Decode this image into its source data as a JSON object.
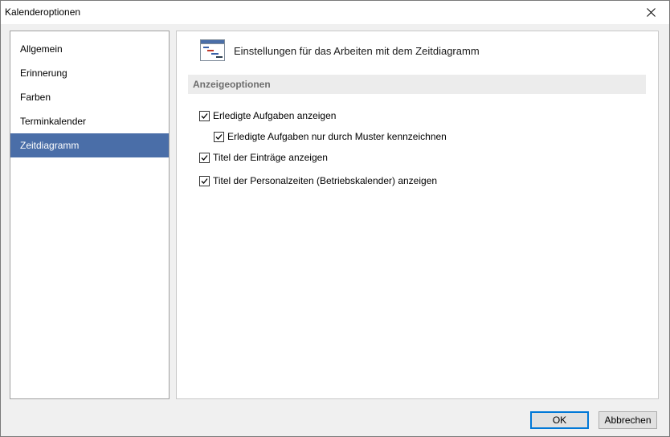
{
  "window": {
    "title": "Kalenderoptionen"
  },
  "nav": {
    "items": [
      {
        "label": "Allgemein",
        "selected": false
      },
      {
        "label": "Erinnerung",
        "selected": false
      },
      {
        "label": "Farben",
        "selected": false
      },
      {
        "label": "Terminkalender",
        "selected": false
      },
      {
        "label": "Zeitdiagramm",
        "selected": true
      }
    ]
  },
  "panel": {
    "header": "Einstellungen für das Arbeiten mit dem Zeitdiagramm",
    "header_icon": "gantt-chart-icon",
    "section_label": "Anzeigeoptionen",
    "options": [
      {
        "label": "Erledigte Aufgaben anzeigen",
        "checked": true
      },
      {
        "label": "Erledigte Aufgaben nur durch Muster kennzeichnen",
        "checked": true
      },
      {
        "label": "Titel der Einträge anzeigen",
        "checked": true
      },
      {
        "label": "Titel der Personalzeiten (Betriebskalender) anzeigen",
        "checked": true
      }
    ]
  },
  "buttons": {
    "ok": "OK",
    "cancel": "Abbrechen"
  },
  "colors": {
    "selection": "#4a6ea8",
    "default_button_border": "#0078d7"
  }
}
